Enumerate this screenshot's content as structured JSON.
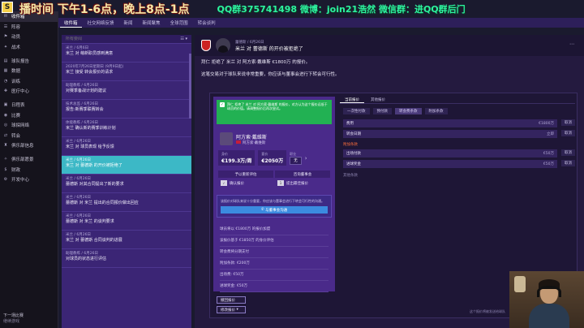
{
  "overlay": {
    "left_text": "播时间 下午1-6点，晚上8点-1点",
    "right_text": "QQ群375741498 微博：join21浩然 微信群：进QQ群后门"
  },
  "sidebar": {
    "items": [
      {
        "label": "收件箱",
        "icon": "inbox-icon",
        "glyph": "✉",
        "active": true
      },
      {
        "label": "阵容",
        "icon": "people-icon",
        "glyph": "☰"
      },
      {
        "label": "动员",
        "icon": "flag-icon",
        "glyph": "⚑"
      },
      {
        "label": "战术",
        "icon": "tactics-icon",
        "glyph": "✦"
      },
      {
        "label": "球队报告",
        "icon": "report-icon",
        "glyph": "▤"
      },
      {
        "label": "数据",
        "icon": "chart-icon",
        "glyph": "▦"
      },
      {
        "label": "训练",
        "icon": "training-icon",
        "glyph": "◔"
      },
      {
        "label": "医疗中心",
        "icon": "medical-icon",
        "glyph": "✚"
      },
      {
        "label": "日程表",
        "icon": "calendar-icon",
        "glyph": "▣"
      },
      {
        "label": "比赛",
        "icon": "ball-icon",
        "glyph": "◉"
      },
      {
        "label": "球探网络",
        "icon": "scout-icon",
        "glyph": "◎"
      },
      {
        "label": "转会",
        "icon": "transfer-icon",
        "glyph": "⇄"
      },
      {
        "label": "俱乐部信息",
        "icon": "club-icon",
        "glyph": "♜"
      },
      {
        "label": "俱乐部愿景",
        "icon": "vision-icon",
        "glyph": "✧"
      },
      {
        "label": "财政",
        "icon": "finance-icon",
        "glyph": "$"
      },
      {
        "label": "开发中心",
        "icon": "dev-center-icon",
        "glyph": "⚙"
      }
    ],
    "footer_time": "下一场比赛",
    "footer_date": "继续游戏"
  },
  "topbar": {
    "tabs": [
      "收件箱",
      "社交网络反馈",
      "新闻",
      "新闻聚焦",
      "全球范围",
      "转会谈判"
    ]
  },
  "message_list": {
    "search_placeholder": "所有要闻",
    "tools": "☷  ▾",
    "items": [
      {
        "meta": "米兰 / 6月6日",
        "subject": "米兰 对 萌新职员感到满意"
      },
      {
        "meta": "2020年7月26日星期日 (9月9日起)",
        "subject": "米兰 接受 转会报价的请求"
      },
      {
        "meta": "助理教练 / 6月26日",
        "subject": "对赛季备战计划的建议"
      },
      {
        "meta": "技术总监 / 6月26日",
        "subject": "报告:新赛季联赛转会"
      },
      {
        "meta": "体能教练 / 6月26日",
        "subject": "米兰 确认新的赛季训练计划"
      },
      {
        "meta": "米兰 / 6月26日",
        "subject": "米兰 对 球员表现 给予反馈"
      },
      {
        "meta": "米兰 / 6月26日",
        "subject": "米兰 对 蕾德斯 的开价被拒绝了",
        "selected": true
      },
      {
        "meta": "米兰 / 6月26日",
        "subject": "蕾德斯 对其合同提出了新的要求"
      },
      {
        "meta": "米兰 / 6月26日",
        "subject": "蕾德斯 对 米兰 提出的合同报价做出回应"
      },
      {
        "meta": "米兰 / 6月26日",
        "subject": "蕾德斯 对 米兰 的谈判要求"
      },
      {
        "meta": "米兰 / 6月26日",
        "subject": "米兰 对 蕾德斯 合同谈判的进展"
      },
      {
        "meta": "助理教练 / 6月26日",
        "subject": "对球员的状态进行评估"
      }
    ]
  },
  "detail": {
    "header_meta": "蕾德斯 / 6月26日",
    "header_subject": "米兰 对 蕾德斯 的开价被拒绝了",
    "line1": "拜仁 拒绝了 米兰 对 阿方索·戴维斯 €1800万 的报价。",
    "line2": "这笔交易对于球队来说非常重要，你应该与董事会进行下转会可行性。"
  },
  "popup": {
    "green_text": "拜仁 拒绝了 米兰 对 阿方索·戴维斯 的报价，对方认为这个报价远低于球员的价值。请调整报价后再次尝试。",
    "player_name": "阿方索·戴维斯",
    "player_tag": "阿方索·戴维斯",
    "value_label": "身价",
    "value": "€199.3万/周",
    "ask_label": "要价",
    "ask": "€2050万",
    "prof_label": "职业",
    "prof": "无",
    "buttons": [
      "予以重新评估",
      "咨询董事会",
      "确认报价",
      "提出最佳报价"
    ],
    "note_text": "该报价对球队来说十分重要，你应该与董事会进行下转会可行性的沟通。",
    "note_button": "与董事会沟通",
    "terms": [
      "球员将以 €1800万 的报价加盟",
      "该报价基于 €1850万 的身价评估",
      "转会费将分期支付",
      "附加条款: €200万",
      "出场费: €50万",
      "进球奖金: €50万"
    ],
    "bottom_buttons": [
      "撤回报价",
      "修改报价"
    ],
    "right_tabs": [
      "当前报价",
      "其他报价"
    ],
    "right_filters": [
      "一次性付款",
      "预付款",
      "转会费条款",
      "附加条款"
    ],
    "rows": [
      {
        "label": "费用",
        "value": "€1800万"
      },
      {
        "label": "转会日期",
        "value": "立即"
      }
    ],
    "section_label": "附加条款",
    "rows2": [
      {
        "label": "出场付款",
        "value": "€50万"
      },
      {
        "label": "进球奖金",
        "value": "€50万"
      }
    ],
    "dim_label": "其他条款",
    "cancel_label": "取消",
    "right_note": "这个报价将被发送给球队",
    "ok_button": "确定"
  }
}
